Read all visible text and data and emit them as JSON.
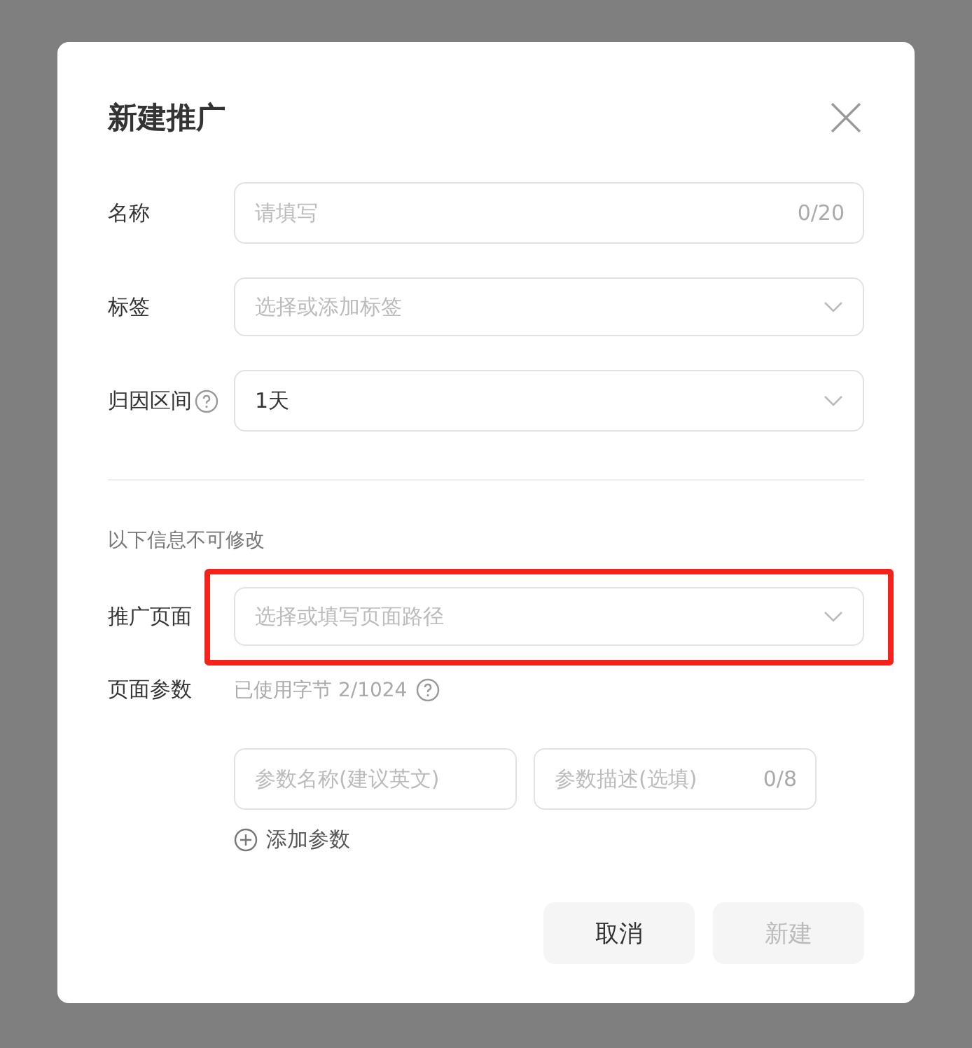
{
  "dialog": {
    "title": "新建推广"
  },
  "fields": [
    {
      "kind": "text",
      "label": "名称",
      "placeholder": "请填写",
      "counter": "0/20",
      "help": false
    },
    {
      "kind": "select",
      "label": "标签",
      "placeholder": "选择或添加标签",
      "help": false
    },
    {
      "kind": "select",
      "label": "归因区间",
      "value": "1天",
      "help": true
    }
  ],
  "notice": "以下信息不可修改",
  "page_field": {
    "kind": "select",
    "label": "推广页面",
    "placeholder": "选择或填写页面路径",
    "highlighted": true
  },
  "params": {
    "label": "页面参数",
    "usage": "已使用字节 2/1024",
    "name_placeholder": "参数名称(建议英文)",
    "desc_placeholder": "参数描述(选填)",
    "desc_counter": "0/8",
    "add": "添加参数"
  },
  "buttons": [
    {
      "label": "取消",
      "disabled": false
    },
    {
      "label": "新建",
      "disabled": true
    }
  ]
}
